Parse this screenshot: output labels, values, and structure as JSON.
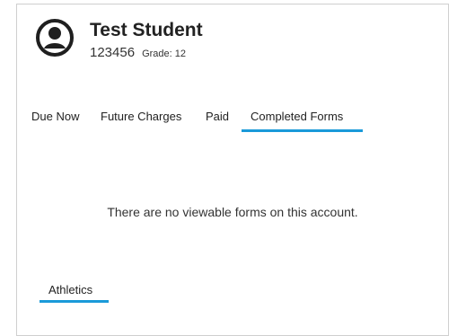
{
  "student": {
    "name": "Test Student",
    "id": "123456",
    "grade_text": "Grade: 12"
  },
  "tabs": [
    {
      "label": "Due Now",
      "active": false
    },
    {
      "label": "Future Charges",
      "active": false
    },
    {
      "label": "Paid",
      "active": false
    },
    {
      "label": "Completed Forms",
      "active": true
    }
  ],
  "content": {
    "empty_message": "There are no viewable forms on this account."
  },
  "section": {
    "tab_label": "Athletics"
  },
  "colors": {
    "accent": "#1a9ad9",
    "border": "#cfcfcf",
    "text": "#222222"
  }
}
